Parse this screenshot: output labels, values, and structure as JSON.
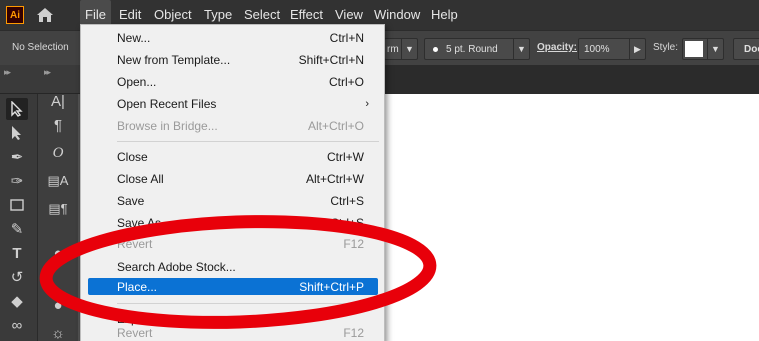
{
  "app": {
    "logo": "Ai"
  },
  "menubar": {
    "items": [
      {
        "label": "File",
        "active": true
      },
      {
        "label": "Edit"
      },
      {
        "label": "Object"
      },
      {
        "label": "Type"
      },
      {
        "label": "Select"
      },
      {
        "label": "Effect"
      },
      {
        "label": "View"
      },
      {
        "label": "Window"
      },
      {
        "label": "Help"
      }
    ]
  },
  "controlbar": {
    "selection": "No Selection",
    "stroke_frag": "rm",
    "brush": "5 pt. Round",
    "opacity_label": "Opacity:",
    "opacity_value": "100%",
    "style_label": "Style:",
    "doc_frag": "Doc"
  },
  "file_menu": {
    "items": [
      {
        "label": "New...",
        "shortcut": "Ctrl+N"
      },
      {
        "label": "New from Template...",
        "shortcut": "Shift+Ctrl+N"
      },
      {
        "label": "Open...",
        "shortcut": "Ctrl+O"
      },
      {
        "label": "Open Recent Files",
        "shortcut": ""
      },
      {
        "label": "Browse in Bridge...",
        "shortcut": "Alt+Ctrl+O",
        "disabled": true
      },
      {
        "label": "Close",
        "shortcut": "Ctrl+W"
      },
      {
        "label": "Close All",
        "shortcut": "Alt+Ctrl+W"
      },
      {
        "label": "Save",
        "shortcut": "Ctrl+S"
      },
      {
        "label": "Save As...",
        "shortcut": "Shift+Ctrl+S"
      },
      {
        "label": "Revert",
        "shortcut": "F12",
        "disabled": true
      },
      {
        "label": "Search Adobe Stock...",
        "shortcut": ""
      },
      {
        "label": "Place...",
        "shortcut": "Shift+Ctrl+P",
        "highlighted": true
      },
      {
        "label": "Export",
        "shortcut": ""
      },
      {
        "label": "Revert",
        "shortcut": "F12",
        "disabled": true
      }
    ]
  },
  "colors": {
    "highlight": "#0b72d4",
    "annotation": "#e8000a",
    "menu_bg": "#f0f0f0",
    "chrome": "#323232"
  }
}
